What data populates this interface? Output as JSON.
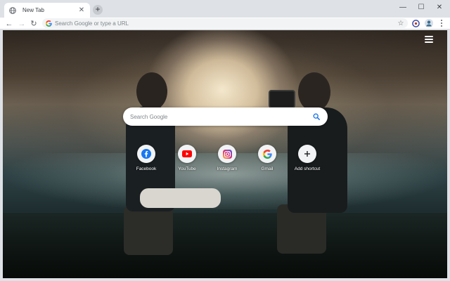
{
  "window": {
    "tab_title": "New Tab",
    "tab_close": "✕",
    "new_tab": "+",
    "controls": {
      "minimize": "—",
      "maximize": "☐",
      "close": "✕"
    }
  },
  "toolbar": {
    "back": "←",
    "forward": "→",
    "reload": "↻",
    "omnibox_placeholder": "Search Google or type a URL",
    "bookmark_star": "☆"
  },
  "search": {
    "placeholder": "Search Google"
  },
  "shortcuts": [
    {
      "label": "Facebook",
      "icon": "facebook-icon",
      "color": "#1877f2"
    },
    {
      "label": "YouTube",
      "icon": "youtube-icon",
      "color": "#ff0000"
    },
    {
      "label": "Instagram",
      "icon": "instagram-icon",
      "color": "#c13584"
    },
    {
      "label": "Gmail",
      "icon": "google-icon",
      "color": "#4285f4"
    },
    {
      "label": "Add shortcut",
      "icon": "plus-icon",
      "color": "#202124"
    }
  ],
  "colors": {
    "accent": "#1a73e8",
    "frame": "#dee1e6",
    "omnibox": "#f1f3f4"
  }
}
